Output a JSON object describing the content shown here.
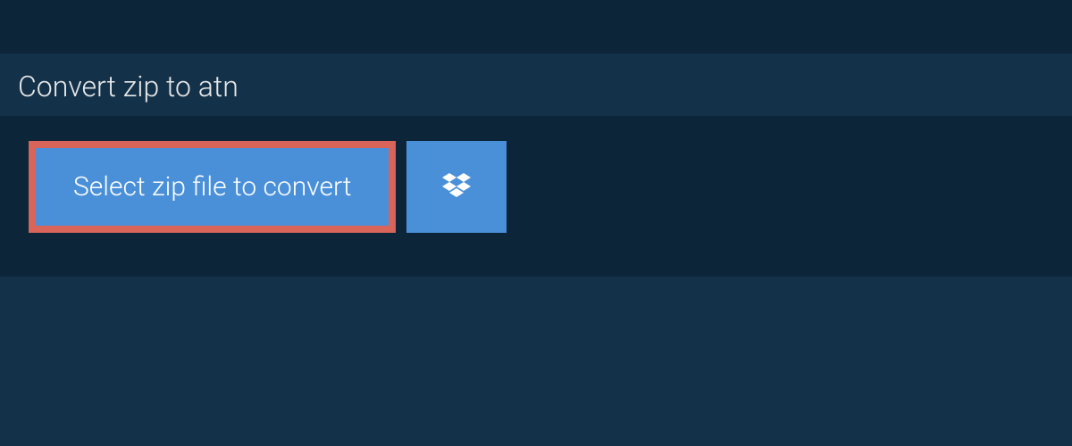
{
  "header": {
    "title": "Convert zip to atn"
  },
  "actions": {
    "select_file_label": "Select zip file to convert",
    "dropbox_icon_name": "dropbox-icon"
  },
  "colors": {
    "background_dark": "#0d2538",
    "background_mid": "#13324a",
    "button_blue": "#4a90d9",
    "highlight_border": "#d96459",
    "text_light": "#e8e8e8",
    "text_white": "#ffffff"
  }
}
